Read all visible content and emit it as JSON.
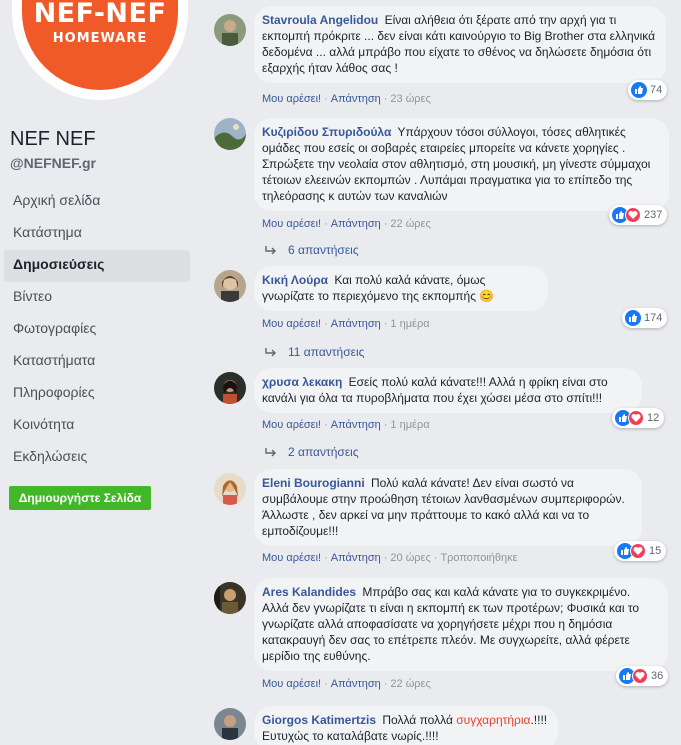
{
  "brand": {
    "logo_title": "NEF-NEF",
    "logo_subtitle": "HOMEWARE",
    "page_name": "NEF NEF",
    "handle": "@NEFNEF.gr"
  },
  "nav": {
    "items": [
      {
        "label": "Αρχική σελίδα"
      },
      {
        "label": "Κατάστημα"
      },
      {
        "label": "Δημοσιεύσεις"
      },
      {
        "label": "Βίντεο"
      },
      {
        "label": "Φωτογραφίες"
      },
      {
        "label": "Καταστήματα"
      },
      {
        "label": "Πληροφορίες"
      },
      {
        "label": "Κοινότητα"
      },
      {
        "label": "Εκδηλώσεις"
      }
    ],
    "active_index": 2
  },
  "create_page_label": "Δημιουργήστε Σελίδα",
  "comments": [
    {
      "author": "Stavroula Angelidou",
      "text": "Είναι αλήθεια ότι ξέρατε από την αρχή για τι εκπομπή πρόκριτε ... δεν είναι κάτι καινούργιο το Big Brother στα ελληνικά δεδομένα ... αλλά μπράβο που είχατε το σθένος να δηλώσετε δημόσια ότι εξαρχής ήταν λάθος σας !",
      "like_label": "Μου αρέσει!",
      "reply_label": "Απάντηση",
      "time": "23 ώρες",
      "reaction_count": "74"
    },
    {
      "author": "Κυζιρίδου Σπυριδούλα",
      "text": "Υπάρχουν τόσοι σύλλογοι, τόσες αθλητικές ομάδες που εσείς οι σοβαρές εταιρείες μπορείτε να κάνετε χορηγίες . Σπρώξετε την νεολαία στον αθλητισμό, στη μουσική, μη γίνεστε σύμμαχοι τέτοιων ελεεινών εκπομπών . Λυπάμαι πραγματικα για το επίπεδο της τηλεόρασης κ αυτών των καναλιών",
      "like_label": "Μου αρέσει!",
      "reply_label": "Απάντηση",
      "time": "22 ώρες",
      "reaction_count": "237",
      "replies": "6 απαντήσεις"
    },
    {
      "author": "Κική Λούρα",
      "text": "Και πολύ καλά κάνατε, όμως γνωρίζατε το περιεχόμενο της εκπομπής",
      "emoji": "😊",
      "like_label": "Μου αρέσει!",
      "reply_label": "Απάντηση",
      "time": "1 ημέρα",
      "reaction_count": "174",
      "replies": "11 απαντήσεις"
    },
    {
      "author": "χρυσα λεκακη",
      "text": "Εσείς πολύ καλά κάνατε!!! Αλλά η φρίκη είναι στο κανάλι για όλα τα πυροβλήματα που έχει χώσει μέσα στο σπίτι!!!",
      "like_label": "Μου αρέσει!",
      "reply_label": "Απάντηση",
      "time": "1 ημέρα",
      "reaction_count": "12",
      "replies": "2 απαντήσεις"
    },
    {
      "author": "Eleni Bourogianni",
      "text": "Πολύ καλά κάνατε! Δεν είναι σωστό να συμβάλουμε στην προώθηση τέτοιων λανθασμένων συμπεριφορών. Άλλωστε , δεν αρκεί να μην πράττουμε το κακό αλλά και να το εμποδίζουμε!!!",
      "like_label": "Μου αρέσει!",
      "reply_label": "Απάντηση",
      "time": "20 ώρες",
      "edited_label": "Τροποποιήθηκε",
      "reaction_count": "15"
    },
    {
      "author": "Ares Kalandides",
      "text": "Μπράβο σας και καλά κάνατε για το συγκεκριμένο. Αλλά δεν γνωρίζατε τι είναι η εκπομπή εκ των προτέρων; Φυσικά και το γνωρίζατε αλλά αποφασίσατε να χορηγήσετε μέχρι που η δημόσια κατακραυγή δεν σας το επέτρεπε πλεόν. Με συγχωρείτε, αλλά φέρετε μερίδιο της ευθύνης.",
      "like_label": "Μου αρέσει!",
      "reply_label": "Απάντηση",
      "time": "22 ώρες",
      "reaction_count": "36"
    },
    {
      "author": "Giorgos Katimertzis",
      "text_before": "Πολλά πολλά",
      "highlight": "συγχαρητήρια",
      "text_after": ".!!!! Ευτυχώς το καταλάβατε νωρίς.!!!!"
    }
  ],
  "colors": {
    "link": "#385898",
    "like": "#1877f2",
    "love": "#f33e58",
    "brand": "#f05a28",
    "create_button": "#42b72a"
  }
}
